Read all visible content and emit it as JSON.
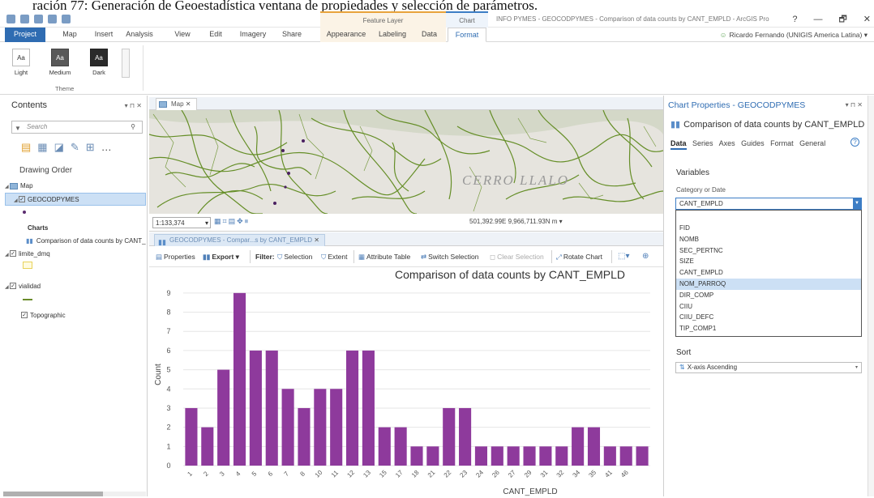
{
  "caption": "ración 77: Generación de Geoestadística ventana de propiedades y selección de parámetros.",
  "titlebar": {
    "context_feature_layer": "Feature Layer",
    "context_chart": "Chart",
    "app_title": "INFO PYMES - GEOCODPYMES - Comparison of data counts by CANT_EMPLD - ArcGIS Pro",
    "help": "?",
    "minimize": "—",
    "restore": "🗗",
    "close": "✕"
  },
  "tabs": {
    "project": "Project",
    "map": "Map",
    "insert": "Insert",
    "analysis": "Analysis",
    "view": "View",
    "edit": "Edit",
    "imagery": "Imagery",
    "share": "Share",
    "appearance": "Appearance",
    "labeling": "Labeling",
    "data": "Data",
    "format": "Format",
    "user": "Ricardo Fernando (UNIGIS America Latina) ▾"
  },
  "ribbon": {
    "theme_light": "Light",
    "theme_medium": "Medium",
    "theme_dark": "Dark",
    "swatch": "Aa",
    "group_label": "Theme"
  },
  "contents": {
    "title": "Contents",
    "controls": "▾ ⊓ ✕",
    "search_placeholder": "Search",
    "drawing_order": "Drawing Order",
    "map": "Map",
    "layer1": "GEOCODPYMES",
    "charts_heading": "Charts",
    "chart_item": "Comparison of data counts by CANT_EMPLD",
    "layer2": "limite_dmq",
    "layer3": "vialidad",
    "layer4": "Topographic"
  },
  "map": {
    "tab": "Map",
    "scale": "1:133,374",
    "coords": "501,392.99E 9,966,711.93N m ▾",
    "place_label": "CERRO LLALO"
  },
  "chart_tab": {
    "label": "GEOCODPYMES - Compar...s by CANT_EMPLD"
  },
  "toolbar": {
    "properties": "Properties",
    "export": "Export ▾",
    "filter": "Filter:",
    "selection": "Selection",
    "extent": "Extent",
    "attribute_table": "Attribute Table",
    "switch_selection": "Switch Selection",
    "clear_selection": "Clear Selection",
    "rotate_chart": "Rotate Chart"
  },
  "chart_data": {
    "type": "bar",
    "title": "Comparison of data counts by CANT_EMPLD",
    "xlabel": "CANT_EMPLD",
    "ylabel": "Count",
    "ylim": [
      0,
      9.5
    ],
    "yticks": [
      0,
      1,
      2,
      3,
      4,
      5,
      6,
      7,
      8,
      9
    ],
    "grid": true,
    "bar_color": "#8e3a9c",
    "categories": [
      "1",
      "2",
      "3",
      "4",
      "5",
      "6",
      "7",
      "8",
      "10",
      "11",
      "12",
      "13",
      "15",
      "17",
      "18",
      "21",
      "22",
      "23",
      "24",
      "26",
      "27",
      "29",
      "31",
      "32",
      "34",
      "35",
      "41",
      "46",
      ""
    ],
    "values": [
      3,
      2,
      5,
      9,
      6,
      6,
      4,
      3,
      4,
      4,
      6,
      6,
      2,
      2,
      1,
      1,
      3,
      3,
      1,
      1,
      1,
      1,
      1,
      1,
      2,
      2,
      1,
      1,
      1
    ]
  },
  "properties": {
    "pane_title": "Chart Properties - GEOCODPYMES",
    "pane_controls": "▾ ⊓ ✕",
    "chart_title": "Comparison of data counts by CANT_EMPLD",
    "tabs": [
      "Data",
      "Series",
      "Axes",
      "Guides",
      "Format",
      "General"
    ],
    "help": "?",
    "variables": "Variables",
    "category_label": "Category or Date",
    "category_value": "CANT_EMPLD",
    "fields": [
      "FID",
      "NOMB",
      "SEC_PERTNC",
      "SIZE",
      "CANT_EMPLD",
      "NOM_PARROQ",
      "DIR_COMP",
      "CIIU",
      "CIIU_DEFC",
      "TIP_COMP1"
    ],
    "highlighted_field": "NOM_PARROQ",
    "sort_heading": "Sort",
    "sort_value": "X-axis Ascending"
  },
  "colors": {
    "accent": "#2f6cb2",
    "bar": "#8e3a9c",
    "map_roads": "#5f8a1e"
  }
}
